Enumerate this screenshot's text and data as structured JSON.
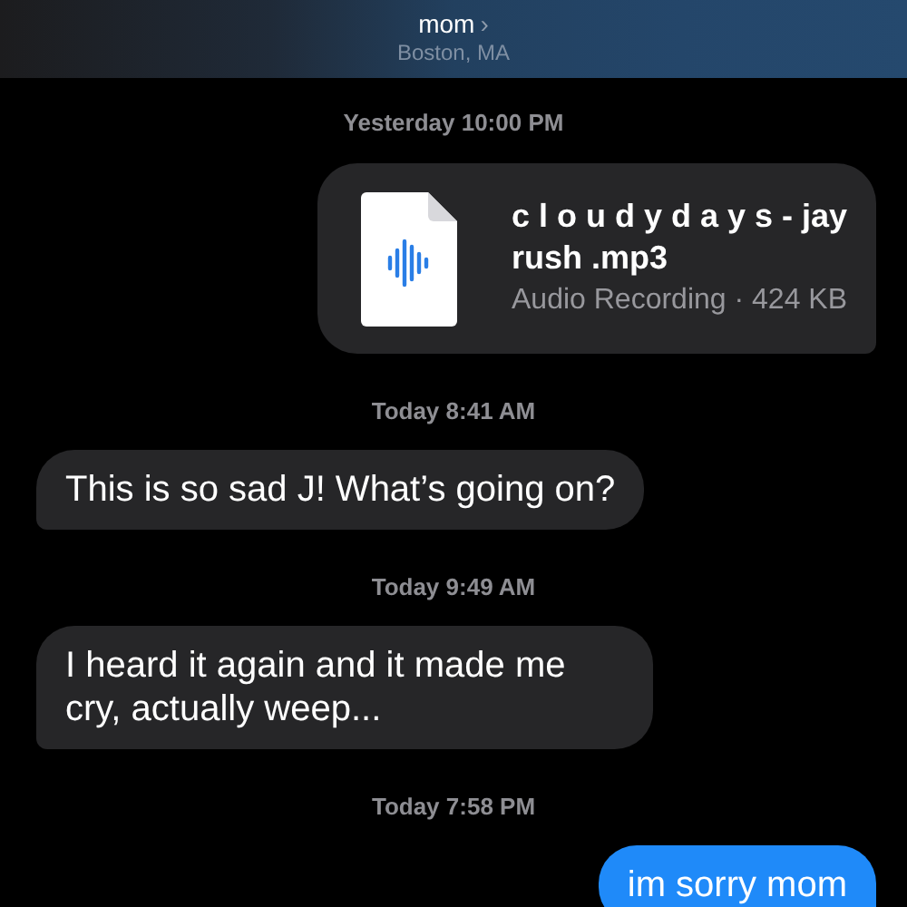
{
  "header": {
    "contact": "mom",
    "chevron": "›",
    "location": "Boston, MA"
  },
  "messages": [
    {
      "kind": "timestamp",
      "text": "Yesterday 10:00 PM"
    },
    {
      "kind": "file",
      "from_me": true,
      "file_name": "c l o u d y d a y s - jay rush .mp3",
      "details": "Audio Recording · 424 KB"
    },
    {
      "kind": "timestamp",
      "text": "Today 8:41 AM"
    },
    {
      "kind": "text",
      "from_me": false,
      "text": "This is so sad J!  What’s going on?"
    },
    {
      "kind": "timestamp",
      "text": "Today 9:49 AM"
    },
    {
      "kind": "text",
      "from_me": false,
      "text": "I heard it again and it made me cry, actually weep..."
    },
    {
      "kind": "timestamp",
      "text": "Today 7:58 PM"
    },
    {
      "kind": "text",
      "from_me": true,
      "text": "im sorry mom"
    }
  ]
}
